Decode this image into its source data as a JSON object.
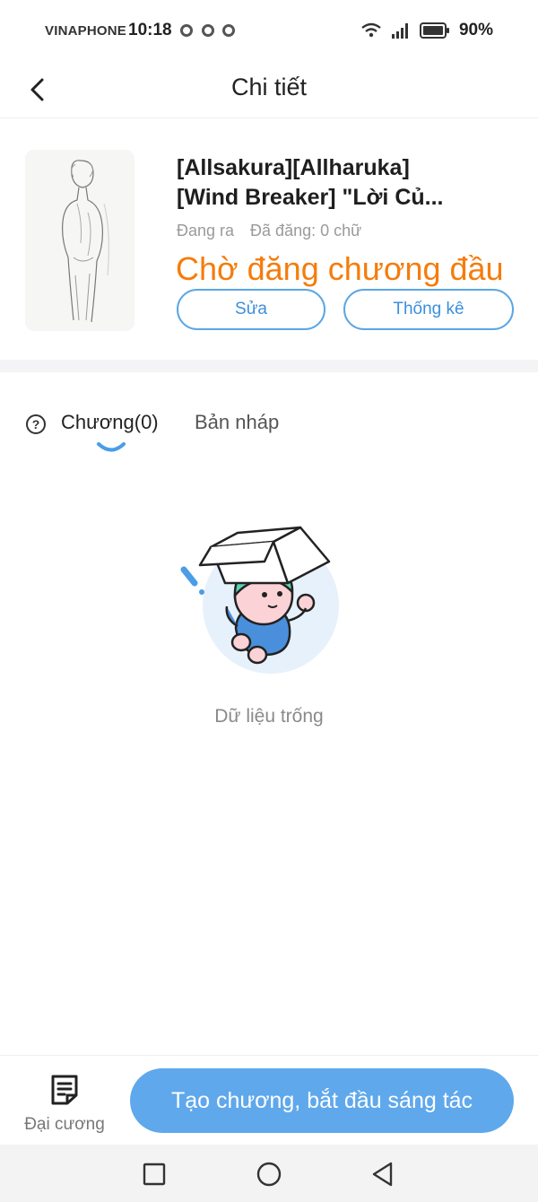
{
  "status_bar": {
    "carrier": "VINAPHONE",
    "time": "10:18",
    "battery": "90%",
    "icons": [
      "chrome-icon",
      "chrome-icon",
      "chrome-icon",
      "wifi-icon",
      "signal-icon",
      "battery-icon"
    ]
  },
  "header": {
    "title": "Chi tiết"
  },
  "book": {
    "title_line1": "[Allsakura][Allharuka]",
    "title_line2": "[Wind Breaker] \"Lời Củ...",
    "state": "Đang ra",
    "published": "Đã đăng: 0 chữ",
    "status": "Chờ đăng chương đầu",
    "edit_label": "Sửa",
    "stats_label": "Thống kê"
  },
  "tabs": {
    "chapters": "Chương(0)",
    "drafts": "Bản nháp",
    "active": "chapters"
  },
  "empty_state": {
    "text": "Dữ liệu trống"
  },
  "bottom": {
    "outline_label": "Đại cương",
    "create_label": "Tạo chương, bắt đầu sáng tác"
  },
  "colors": {
    "accent": "#5fa8ec",
    "status_orange": "#f57c0a",
    "outline_blue": "#5aa6e6"
  }
}
